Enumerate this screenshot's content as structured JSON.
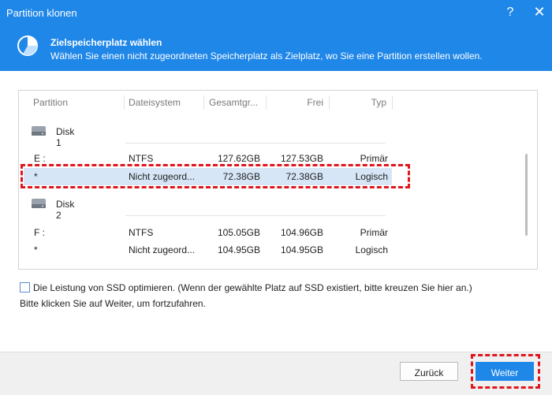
{
  "window": {
    "title": "Partition klonen",
    "help_glyph": "?",
    "close_glyph": "✕"
  },
  "header": {
    "icon": "pie-chart-icon",
    "title": "Zielspeicherplatz wählen",
    "subtitle": "Wählen Sie einen nicht zugeordneten Speicherplatz als Zielplatz, wo Sie eine Partition erstellen wollen."
  },
  "table": {
    "columns": [
      "Partition",
      "Dateisystem",
      "Gesamtgr...",
      "Frei",
      "Typ"
    ],
    "disks": [
      {
        "label": "Disk 1",
        "rows": [
          {
            "partition": "E :",
            "fs": "NTFS",
            "total": "127.62GB",
            "free": "127.53GB",
            "type": "Primär"
          },
          {
            "partition": "*",
            "fs": "Nicht zugeord...",
            "total": "72.38GB",
            "free": "72.38GB",
            "type": "Logisch"
          }
        ]
      },
      {
        "label": "Disk 2",
        "rows": [
          {
            "partition": "F :",
            "fs": "NTFS",
            "total": "105.05GB",
            "free": "104.96GB",
            "type": "Primär"
          },
          {
            "partition": "*",
            "fs": "Nicht zugeord...",
            "total": "104.95GB",
            "free": "104.95GB",
            "type": "Logisch"
          }
        ]
      }
    ]
  },
  "option": {
    "label": "Die Leistung von SSD optimieren. (Wenn der gewählte Platz auf SSD existiert, bitte kreuzen Sie hier an.)",
    "checked": false
  },
  "hint": "Bitte klicken Sie auf Weiter, um fortzufahren.",
  "buttons": {
    "back": "Zurück",
    "next": "Weiter"
  },
  "colors": {
    "accent": "#1f87e8",
    "highlight": "#e0161d",
    "selected_row": "#d7e6f6"
  }
}
